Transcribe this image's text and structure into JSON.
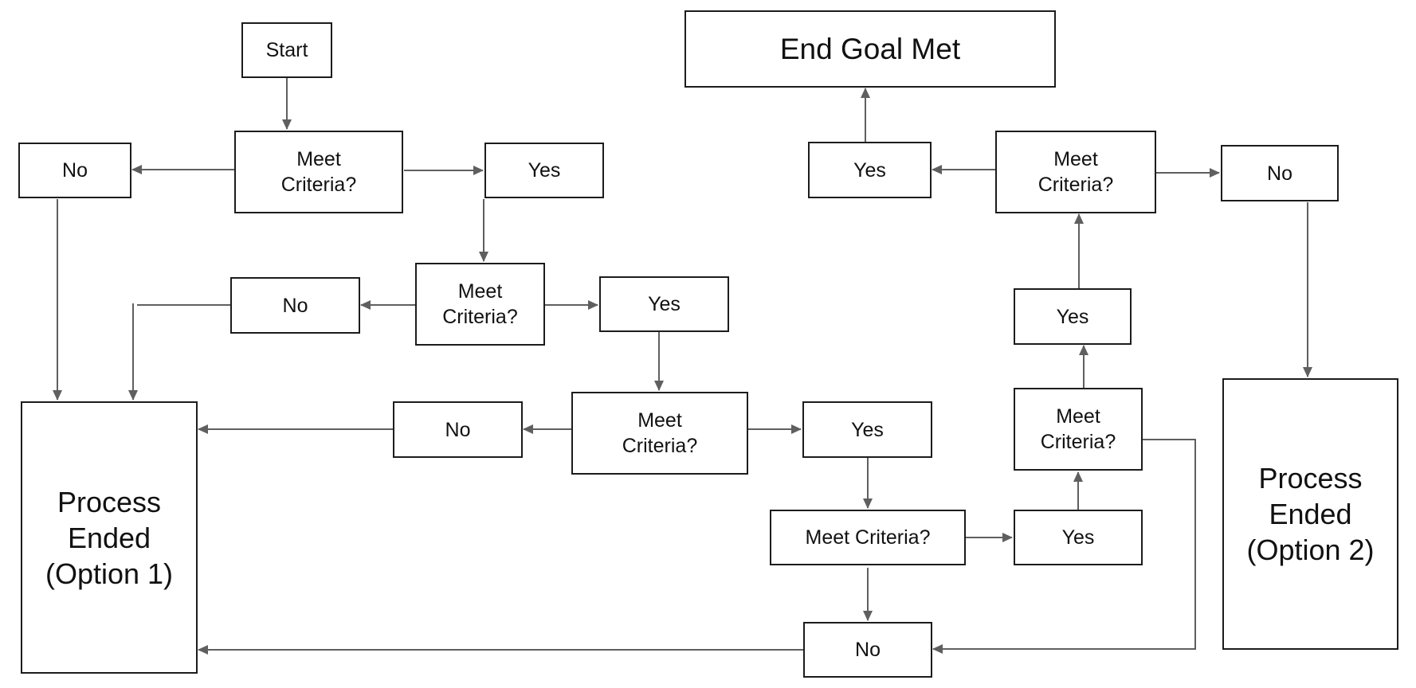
{
  "diagram": {
    "type": "flowchart",
    "nodes": [
      {
        "id": "start",
        "label": "Start"
      },
      {
        "id": "mc1",
        "label": "Meet\nCriteria?"
      },
      {
        "id": "no1",
        "label": "No"
      },
      {
        "id": "yes1",
        "label": "Yes"
      },
      {
        "id": "mc2",
        "label": "Meet\nCriteria?"
      },
      {
        "id": "no2",
        "label": "No"
      },
      {
        "id": "yes2",
        "label": "Yes"
      },
      {
        "id": "mc3",
        "label": "Meet\nCriteria?"
      },
      {
        "id": "no3",
        "label": "No"
      },
      {
        "id": "yes3",
        "label": "Yes"
      },
      {
        "id": "mc4",
        "label": "Meet Criteria?"
      },
      {
        "id": "yes4",
        "label": "Yes"
      },
      {
        "id": "no4",
        "label": "No"
      },
      {
        "id": "mc5",
        "label": "Meet\nCriteria?"
      },
      {
        "id": "yes5",
        "label": "Yes"
      },
      {
        "id": "mc6",
        "label": "Meet\nCriteria?"
      },
      {
        "id": "yes6",
        "label": "Yes"
      },
      {
        "id": "no6",
        "label": "No"
      },
      {
        "id": "goal",
        "label": "End Goal Met"
      },
      {
        "id": "end1",
        "label": "Process\nEnded\n(Option 1)"
      },
      {
        "id": "end2",
        "label": "Process\nEnded\n(Option 2)"
      }
    ],
    "edges": [
      {
        "from": "start",
        "to": "mc1"
      },
      {
        "from": "mc1",
        "to": "no1"
      },
      {
        "from": "mc1",
        "to": "yes1"
      },
      {
        "from": "no1",
        "to": "end1"
      },
      {
        "from": "yes1",
        "to": "mc2"
      },
      {
        "from": "mc2",
        "to": "no2"
      },
      {
        "from": "mc2",
        "to": "yes2"
      },
      {
        "from": "no2",
        "to": "end1"
      },
      {
        "from": "yes2",
        "to": "mc3"
      },
      {
        "from": "mc3",
        "to": "no3"
      },
      {
        "from": "mc3",
        "to": "yes3"
      },
      {
        "from": "no3",
        "to": "end1"
      },
      {
        "from": "yes3",
        "to": "mc4"
      },
      {
        "from": "mc4",
        "to": "yes4"
      },
      {
        "from": "mc4",
        "to": "no4"
      },
      {
        "from": "no4",
        "to": "end1"
      },
      {
        "from": "yes4",
        "to": "mc5"
      },
      {
        "from": "mc5",
        "to": "yes5"
      },
      {
        "from": "mc5",
        "to": "no4"
      },
      {
        "from": "yes5",
        "to": "mc6"
      },
      {
        "from": "mc6",
        "to": "yes6"
      },
      {
        "from": "mc6",
        "to": "no6"
      },
      {
        "from": "yes6",
        "to": "goal"
      },
      {
        "from": "no6",
        "to": "end2"
      }
    ]
  },
  "colors": {
    "border": "#1c1c1c",
    "connector": "#5f5f5f",
    "background": "#ffffff"
  }
}
